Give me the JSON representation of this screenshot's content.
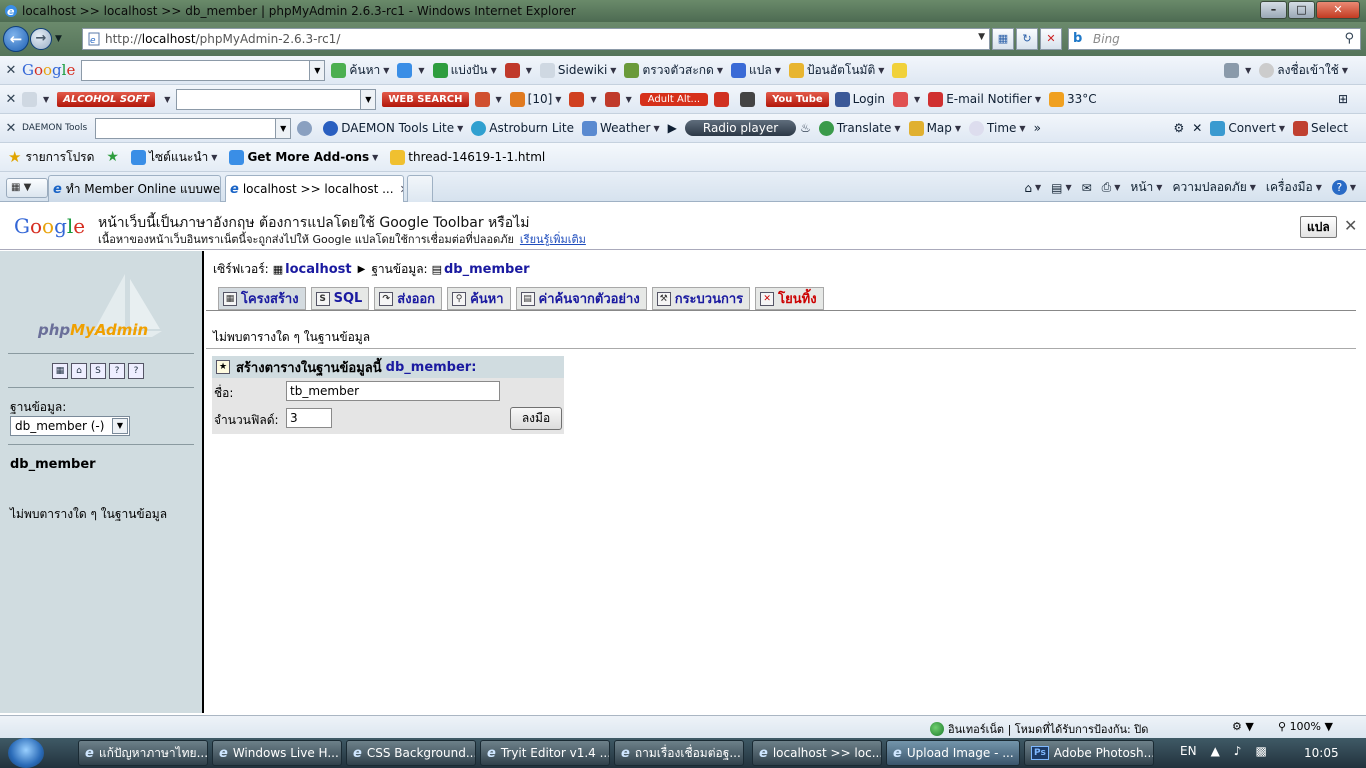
{
  "window": {
    "title": "localhost >> localhost >> db_member | phpMyAdmin 2.6.3-rc1 - Windows Internet Explorer",
    "minimize": "–",
    "maximize": "□",
    "close": "✕"
  },
  "address_bar": {
    "url_prefix": "http://",
    "url_host": "localhost",
    "url_path": "/phpMyAdmin-2.6.3-rc1/",
    "search_placeholder": "Bing"
  },
  "toolbars": {
    "google": {
      "label": "Google",
      "search": "ค้นหา",
      "share": "แบ่งปัน",
      "sidewiki": "Sidewiki",
      "spell": "ตรวจตัวสะกด",
      "translate": "แปล",
      "autofill": "ป้อนอัตโนมัติ",
      "signin": "ลงชื่อเข้าใช้"
    },
    "alcohol": {
      "brand": "ALCOHOL SOFT",
      "web_search": "WEB SEARCH",
      "count": "[10]",
      "adult_alert": "Adult Alt...",
      "youtube": "You Tube",
      "login": "Login",
      "email_notifier": "E-mail Notifier",
      "weather_temp": "33°C"
    },
    "daemon": {
      "brand": "DAEMON Tools",
      "lite": "DAEMON Tools Lite",
      "astroburn": "Astroburn Lite",
      "weather": "Weather",
      "radio": "Radio player",
      "translate": "Translate",
      "map": "Map",
      "time": "Time",
      "more": "»",
      "convert": "Convert",
      "select": "Select"
    }
  },
  "favorites_bar": {
    "favorites": "รายการโปรด",
    "suggested": "ไซต์แนะนำ",
    "addons": "Get More Add-ons",
    "thread": "thread-14619-1-1.html"
  },
  "tabs": [
    {
      "label": "ทำ Member Online แบบwe..."
    },
    {
      "label": "localhost >> localhost ..."
    }
  ],
  "command_bar": {
    "page": "หน้า",
    "safety": "ความปลอดภัย",
    "tools": "เครื่องมือ"
  },
  "translate_bar": {
    "logo": "Google",
    "line1": "หน้าเว็บนี้เป็นภาษาอังกฤษ ต้องการแปลโดยใช้ Google Toolbar หรือไม่",
    "line2": "เนื้อหาของหน้าเว็บอินทราเน็ตนี้จะถูกส่งไปให้ Google แปลโดยใช้การเชื่อมต่อที่ปลอดภัย",
    "learn_more": "เรียนรู้เพิ่มเติม",
    "translate_button": "แปล",
    "close": "✕"
  },
  "left_panel": {
    "logo_php": "php",
    "logo_myadmin": "MyAdmin",
    "database_label": "ฐานข้อมูล:",
    "database_selected": "db_member (-)",
    "current_db": "db_member",
    "no_tables": "ไม่พบตารางใด ๆ ในฐานข้อมูล"
  },
  "main": {
    "server_label": "เซิร์ฟเวอร์:",
    "server_name": "localhost",
    "db_label": "ฐานข้อมูล:",
    "db_name": "db_member",
    "tabs": [
      {
        "label": "โครงสร้าง"
      },
      {
        "label": "SQL"
      },
      {
        "label": "ส่งออก"
      },
      {
        "label": "ค้นหา"
      },
      {
        "label": "ค่าค้นจากตัวอย่าง"
      },
      {
        "label": "กระบวนการ"
      },
      {
        "label": "โยนทิ้ง"
      }
    ],
    "no_tables": "ไม่พบตารางใด ๆ ในฐานข้อมูล",
    "create_table": {
      "heading": "สร้างตารางในฐานข้อมูลนี้",
      "db_ref": "db_member:",
      "name_label": "ชื่อ:",
      "name_value": "tb_member",
      "fields_label": "จำนวนฟิลด์:",
      "fields_value": "3",
      "go_button": "ลงมือ"
    }
  },
  "status_bar": {
    "zone": "อินเทอร์เน็ต | โหมดที่ได้รับการป้องกัน: ปิด",
    "zoom": "100%"
  },
  "taskbar": {
    "items": [
      {
        "label": "แก้ปัญหาภาษาไทย..."
      },
      {
        "label": "Windows Live H..."
      },
      {
        "label": "CSS Background..."
      },
      {
        "label": "Tryit Editor v1.4 ..."
      },
      {
        "label": "ถามเรื่องเชื่อมต่อฐ..."
      },
      {
        "label": "localhost >> loc..."
      },
      {
        "label": "Upload Image - ..."
      },
      {
        "label": "Adobe Photosh..."
      }
    ],
    "language": "EN",
    "clock": "10:05"
  }
}
